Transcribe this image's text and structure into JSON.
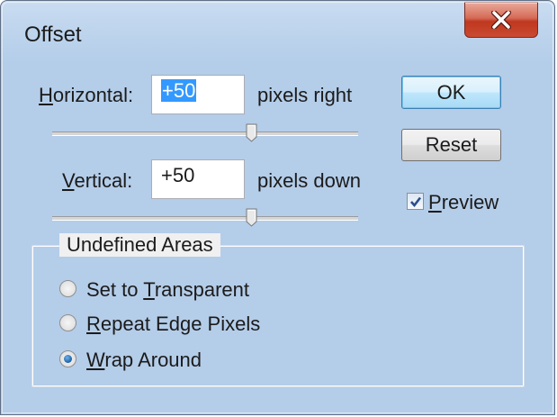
{
  "window": {
    "title": "Offset"
  },
  "horizontal": {
    "label_prefix": "",
    "label_accel": "H",
    "label_rest": "orizontal:",
    "value": "+50",
    "unit": "pixels right"
  },
  "vertical": {
    "label_accel": "V",
    "label_rest": "ertical:",
    "value": "+50",
    "unit": "pixels down"
  },
  "buttons": {
    "ok": "OK",
    "reset": "Reset"
  },
  "preview": {
    "accel": "P",
    "rest": "review",
    "checked": true
  },
  "undefined_areas": {
    "title": "Undefined Areas",
    "options": [
      {
        "pre": "Set to ",
        "accel": "T",
        "post": "ransparent",
        "selected": false
      },
      {
        "pre": "",
        "accel": "R",
        "post": "epeat Edge Pixels",
        "selected": false
      },
      {
        "pre": "",
        "accel": "W",
        "post": "rap Around",
        "selected": true
      }
    ]
  },
  "icons": {
    "close": "close-icon",
    "check": "checkmark-icon",
    "slider_thumb": "slider-thumb-icon"
  }
}
